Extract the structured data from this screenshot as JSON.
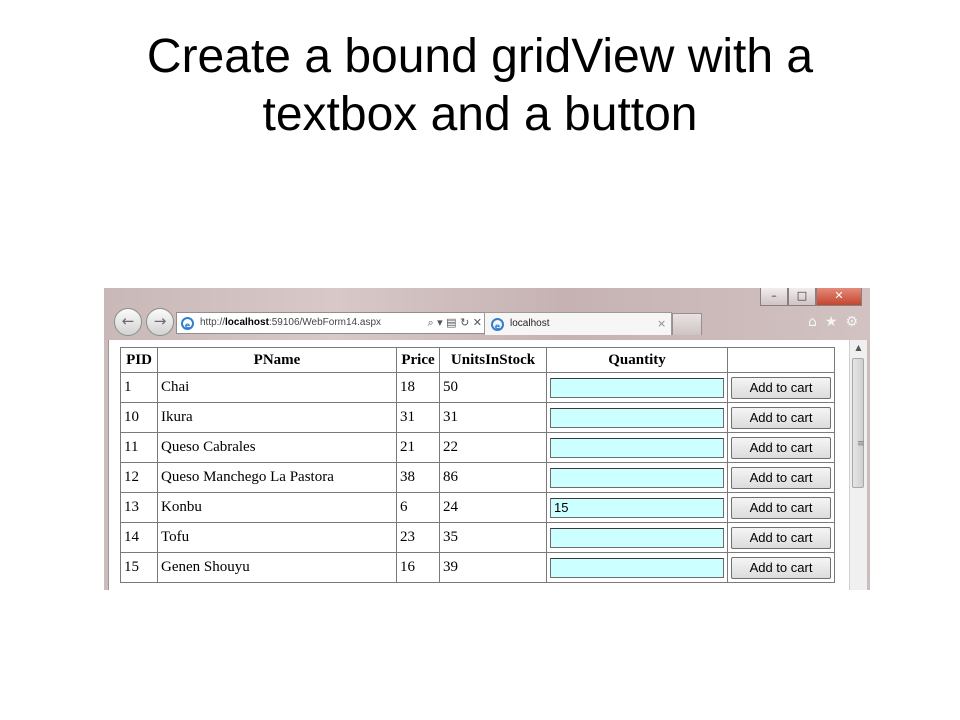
{
  "slide": {
    "title_line1": "Create a bound gridView with a",
    "title_line2": "textbox and a button"
  },
  "browser": {
    "window_buttons": {
      "minimize": "–",
      "maximize": "□",
      "close": "✕"
    },
    "back_icon": "back-arrow-icon",
    "forward_icon": "forward-arrow-icon",
    "address": {
      "prefix": "http://",
      "host": "localhost",
      "rest": ":59106/WebForm14.aspx",
      "tools": "⌕ ▾ ▤ ↻ ✕"
    },
    "tab": {
      "title": "localhost",
      "close": "×"
    },
    "toolbar_icons": {
      "home": "⌂",
      "favorites": "★",
      "tools": "⚙"
    }
  },
  "grid": {
    "headers": [
      "PID",
      "PName",
      "Price",
      "UnitsInStock",
      "Quantity",
      ""
    ],
    "button_label": "Add to cart",
    "rows": [
      {
        "pid": "1",
        "name": "Chai",
        "price": "18",
        "stock": "50",
        "qty": ""
      },
      {
        "pid": "10",
        "name": "Ikura",
        "price": "31",
        "stock": "31",
        "qty": ""
      },
      {
        "pid": "11",
        "name": "Queso Cabrales",
        "price": "21",
        "stock": "22",
        "qty": ""
      },
      {
        "pid": "12",
        "name": "Queso Manchego La Pastora",
        "price": "38",
        "stock": "86",
        "qty": ""
      },
      {
        "pid": "13",
        "name": "Konbu",
        "price": "6",
        "stock": "24",
        "qty": "15"
      },
      {
        "pid": "14",
        "name": "Tofu",
        "price": "23",
        "stock": "35",
        "qty": ""
      },
      {
        "pid": "15",
        "name": "Genen Shouyu",
        "price": "16",
        "stock": "39",
        "qty": ""
      }
    ]
  },
  "colors": {
    "quantity_bg": "#ccffff",
    "close_button": "#c4452e"
  }
}
